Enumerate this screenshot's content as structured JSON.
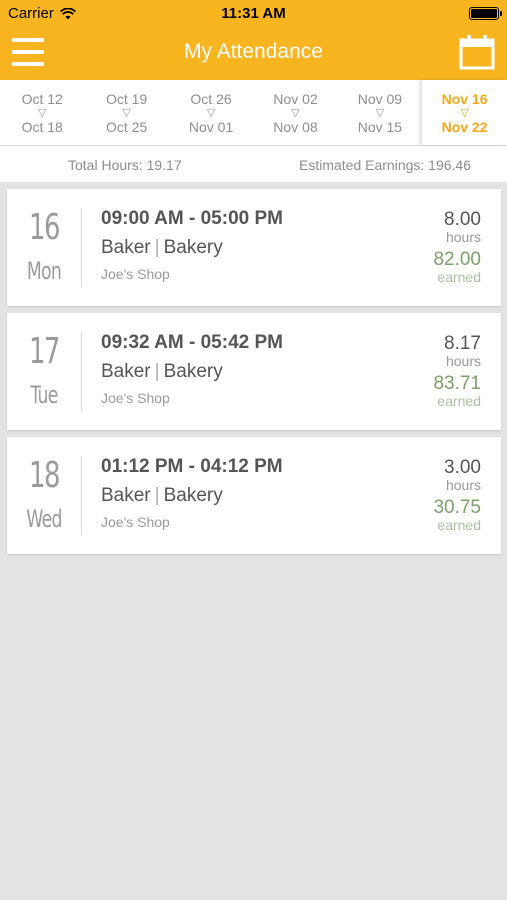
{
  "status_bar": {
    "carrier": "Carrier",
    "time": "11:31 AM"
  },
  "header": {
    "title": "My Attendance",
    "menu_icon": "hamburger-menu-icon",
    "calendar_icon": "calendar-icon"
  },
  "colors": {
    "accent": "#f9b51f",
    "active_week": "#f3a713",
    "earned": "#7aa26a"
  },
  "weeks": [
    {
      "start": "Oct 12",
      "end": "Oct 18"
    },
    {
      "start": "Oct 19",
      "end": "Oct 25"
    },
    {
      "start": "Oct 26",
      "end": "Nov 01"
    },
    {
      "start": "Nov 02",
      "end": "Nov 08"
    },
    {
      "start": "Nov 09",
      "end": "Nov 15"
    },
    {
      "start": "Nov 16",
      "end": "Nov 22"
    }
  ],
  "summary": {
    "total_hours": "Total Hours: 19.17",
    "estimated_earnings": "Estimated Earnings: 196.46"
  },
  "shifts": [
    {
      "day_number": "16",
      "day_name": "Mon",
      "time_range": "09:00 AM - 05:00 PM",
      "position": "Baker",
      "department": "Bakery",
      "location": "Joe's Shop",
      "hours": "8.00",
      "hours_label": "hours",
      "earned": "82.00",
      "earned_label": "earned"
    },
    {
      "day_number": "17",
      "day_name": "Tue",
      "time_range": "09:32 AM - 05:42 PM",
      "position": "Baker",
      "department": "Bakery",
      "location": "Joe's Shop",
      "hours": "8.17",
      "hours_label": "hours",
      "earned": "83.71",
      "earned_label": "earned"
    },
    {
      "day_number": "18",
      "day_name": "Wed",
      "time_range": "01:12 PM - 04:12 PM",
      "position": "Baker",
      "department": "Bakery",
      "location": "Joe's Shop",
      "hours": "3.00",
      "hours_label": "hours",
      "earned": "30.75",
      "earned_label": "earned"
    }
  ],
  "triangle_glyph": "▽",
  "separator": "|"
}
